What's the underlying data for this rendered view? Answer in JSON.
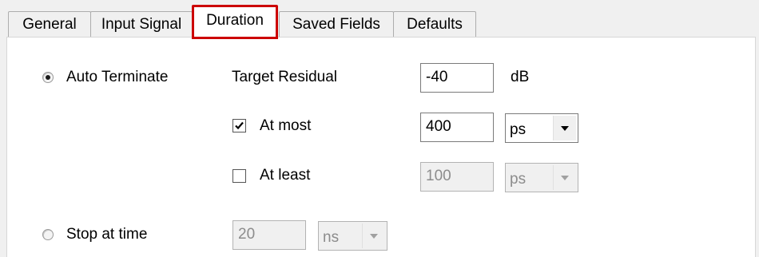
{
  "tabs": [
    {
      "label": "General"
    },
    {
      "label": "Input Signal"
    },
    {
      "label": "Duration"
    },
    {
      "label": "Saved Fields"
    },
    {
      "label": "Defaults"
    }
  ],
  "auto_terminate": {
    "label": "Auto Terminate",
    "selected": true,
    "target_residual": {
      "label": "Target Residual",
      "value": "-40",
      "unit": "dB"
    },
    "at_most": {
      "label": "At most",
      "checked": true,
      "value": "400",
      "unit": "ps"
    },
    "at_least": {
      "label": "At least",
      "checked": false,
      "value": "100",
      "unit": "ps"
    }
  },
  "stop_at_time": {
    "label": "Stop at time",
    "selected": false,
    "value": "20",
    "unit": "ns"
  },
  "icons": {
    "dropdown": "chevron-down-icon",
    "check": "checkmark-icon"
  }
}
